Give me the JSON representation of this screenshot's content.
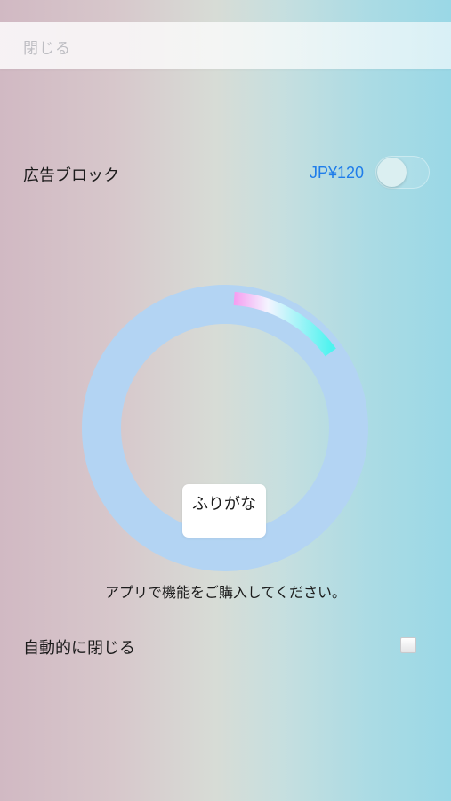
{
  "header": {
    "close_label": "閉じる"
  },
  "ad_block": {
    "label": "広告ブロック",
    "price": "JP¥120",
    "enabled": false
  },
  "loader": {
    "tooltip_text": "ふりがな",
    "progress": 0.14
  },
  "purchase_message": "アプリで機能をご購入してください。",
  "auto_close": {
    "label": "自動的に閉じる",
    "checked": false
  },
  "colors": {
    "accent_blue": "#1f7dea",
    "ring": "#b3d4f3",
    "progress_start": "#f59df0",
    "progress_end": "#4ff3ef"
  }
}
